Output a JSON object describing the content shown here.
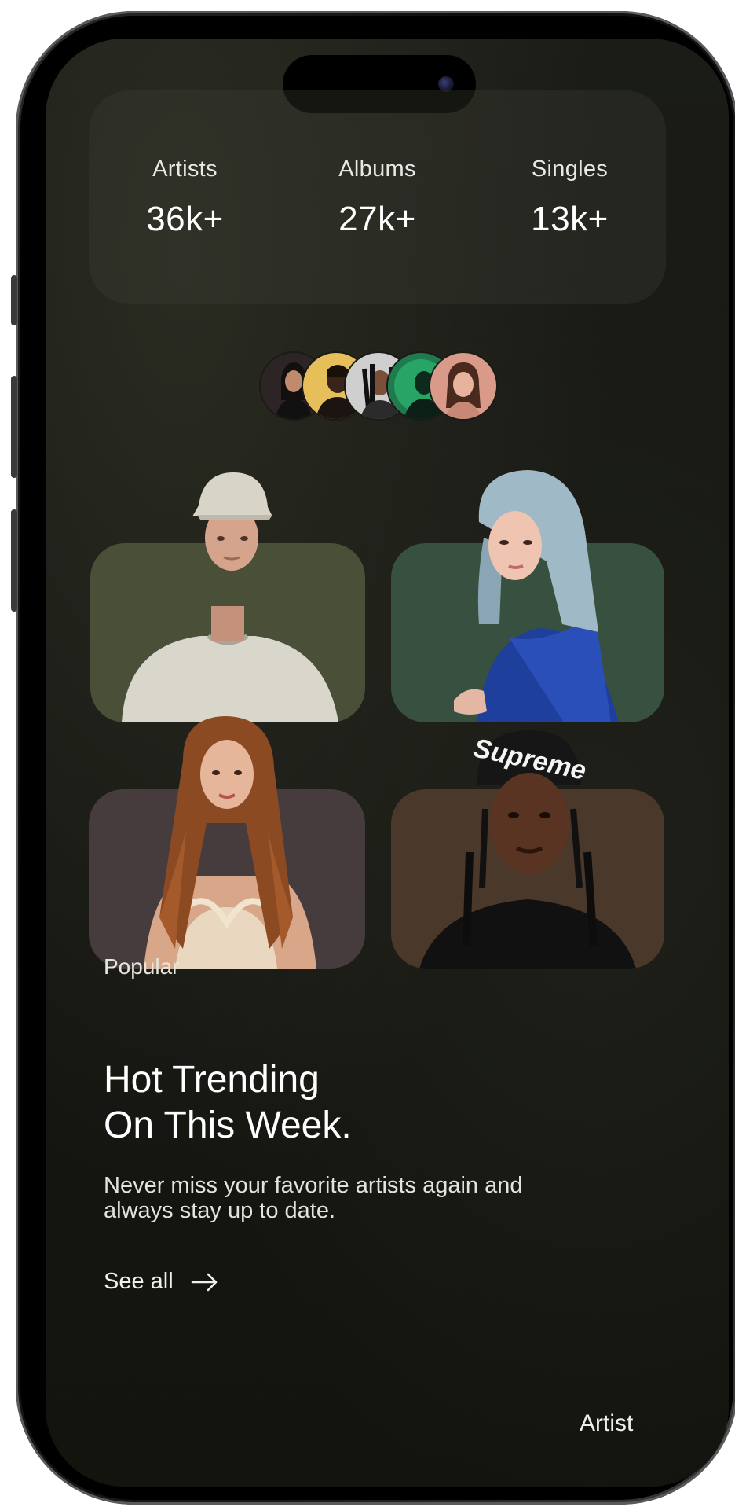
{
  "stats": [
    {
      "label": "Artists",
      "value": "36k+"
    },
    {
      "label": "Albums",
      "value": "27k+"
    },
    {
      "label": "Singles",
      "value": "13k+"
    }
  ],
  "section": {
    "eyebrow": "Popular",
    "title_line1": "Hot Trending",
    "title_line2": "On This Week.",
    "description": "Never miss your favorite artists again and always stay up to date.",
    "see_all": "See all"
  },
  "footer": {
    "artist_link": "Artist"
  },
  "colors": {
    "card_olive": "#4a4f38",
    "card_teal": "#37503f",
    "card_mauve": "#463c3d",
    "card_brown": "#4a382b"
  },
  "icons": {
    "see_all": "arrow-right-icon",
    "camera": "front-camera-icon"
  }
}
